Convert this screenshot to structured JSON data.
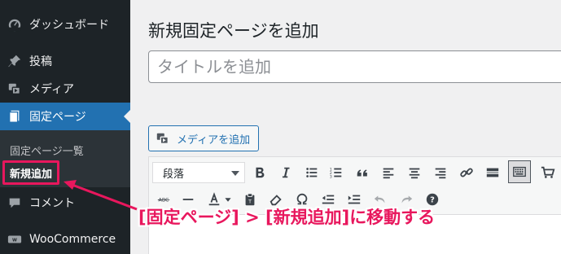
{
  "sidebar": {
    "items": [
      {
        "label": "ダッシュボード",
        "icon": "dashboard-icon"
      },
      {
        "label": "投稿",
        "icon": "pushpin-icon"
      },
      {
        "label": "メディア",
        "icon": "media-icon"
      },
      {
        "label": "固定ページ",
        "icon": "pages-icon"
      },
      {
        "label": "コメント",
        "icon": "comment-icon"
      },
      {
        "label": "WooCommerce",
        "icon": "woocommerce-icon"
      }
    ],
    "submenu": [
      {
        "label": "固定ページ一覧"
      },
      {
        "label": "新規追加"
      }
    ]
  },
  "main": {
    "page_title": "新規固定ページを追加",
    "title_placeholder": "タイトルを追加",
    "media_button_label": "メディアを追加",
    "format_select_value": "段落"
  },
  "annotation": {
    "text": "[固定ページ] > [新規追加]に移動する",
    "color": "#e8175d"
  },
  "colors": {
    "sidebar_bg": "#1d2327",
    "active_bg": "#2271b1",
    "accent": "#e8175d"
  }
}
